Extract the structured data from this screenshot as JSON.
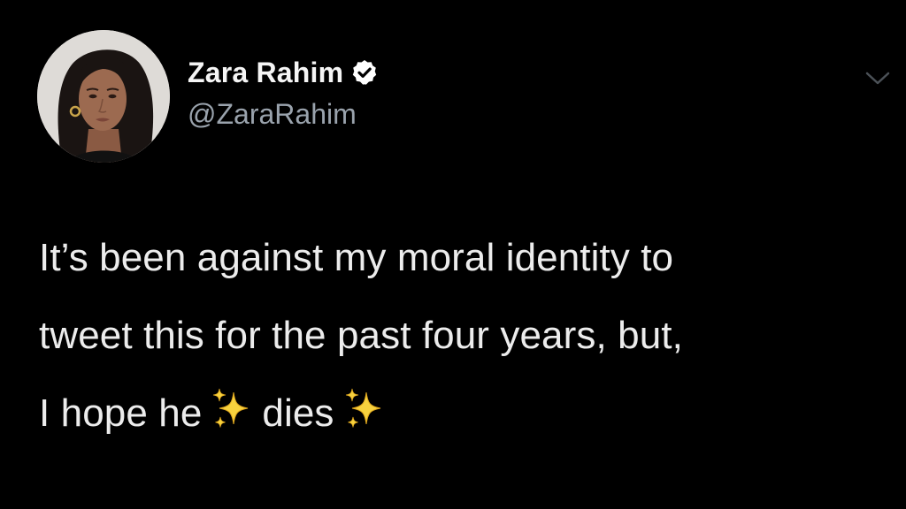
{
  "tweet": {
    "author": {
      "display_name": "Zara Rahim",
      "handle": "@ZaraRahim",
      "verified": true
    },
    "text_lines": [
      "It’s been against my moral identity to",
      "tweet this for the past four years, but,"
    ],
    "line3_part1": "I hope he",
    "line3_part2": "dies",
    "inline_emoji": "sparkles-icon",
    "footer": {
      "timestamp": "",
      "source": ""
    }
  },
  "colors": {
    "background": "#000000",
    "text": "#ececec",
    "handle": "#9aa3ad",
    "verified_badge": "#ffffff",
    "chevron": "#4b5157",
    "link": "#1d9bf0"
  },
  "icons": [
    "verified-badge-icon",
    "chevron-down-icon",
    "sparkles-icon"
  ]
}
